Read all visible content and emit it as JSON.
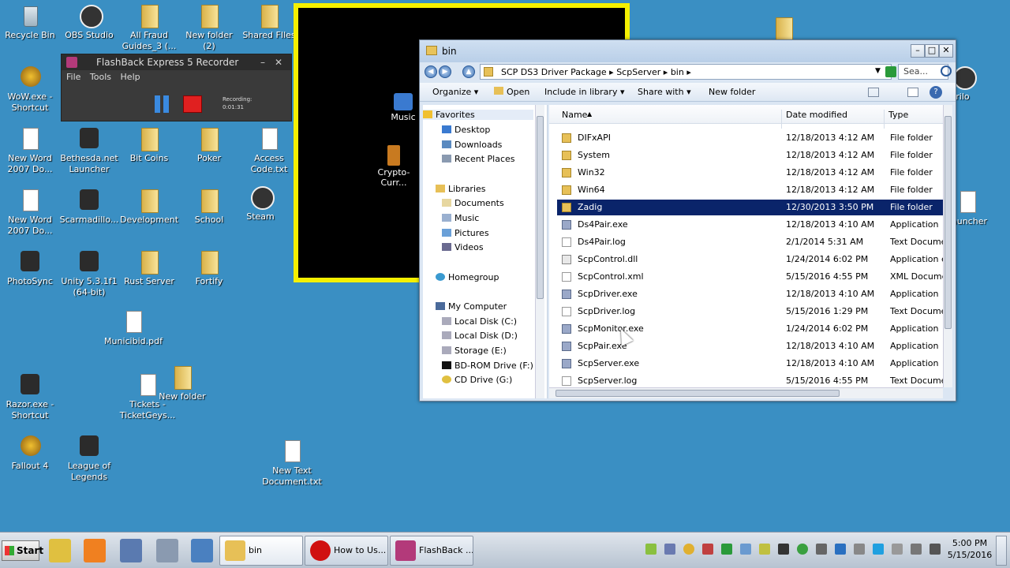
{
  "desktop": {
    "icons": {
      "recycle_bin": "Recycle Bin",
      "obs_studio": "OBS Studio",
      "all_fraud": "All Fraud Guides_3 (...",
      "new_folder_2": "New folder (2)",
      "shared_files": "Shared FIles",
      "wow": "WoW.exe - Shortcut",
      "new_word_1": "New Word 2007 Do...",
      "bethesda": "Bethesda.net Launcher",
      "bit_coins": "Bit Coins",
      "poker": "Poker",
      "access_code": "Access Code.txt",
      "new_word_2": "New Word 2007 Do...",
      "scarmadillo": "Scarmadillo...",
      "development": "Development",
      "school": "School",
      "steam": "Steam",
      "photosync": "PhotoSync",
      "unity": "Unity 5.3.1f1 (64-bit)",
      "rust_server": "Rust Server",
      "fortify": "Fortify",
      "municibid": "Municibid.pdf",
      "razor": "Razor.exe - Shortcut",
      "tickets": "Tickets - TicketGeys...",
      "new_folder": "New folder",
      "fallout4": "Fallout 4",
      "lol": "League of Legends",
      "new_text_doc": "New Text Document.txt",
      "ventrilo_partial": "ntrilo",
      "launcher_partial": "auncher"
    }
  },
  "flashback": {
    "title": "FlashBack Express 5 Recorder",
    "minimize": "–",
    "close": "✕",
    "menu": [
      "File",
      "Tools",
      "Help"
    ],
    "recording_label": "Recording:",
    "recording_time": "0:01:31"
  },
  "media_window": {
    "music": "Music",
    "crypto": "Crypto-Curr..."
  },
  "explorer": {
    "title": "bin",
    "address": [
      "SCP DS3 Driver Package",
      "ScpServer",
      "bin"
    ],
    "search_placeholder": "Sea...",
    "toolbar": {
      "organize": "Organize",
      "open": "Open",
      "include": "Include in library",
      "share": "Share with",
      "new_folder": "New folder"
    },
    "nav": {
      "favorites": "Favorites",
      "desktop": "Desktop",
      "downloads": "Downloads",
      "recent": "Recent Places",
      "libraries": "Libraries",
      "documents": "Documents",
      "music": "Music",
      "pictures": "Pictures",
      "videos": "Videos",
      "homegroup": "Homegroup",
      "my_computer": "My Computer",
      "local_c": "Local Disk (C:)",
      "local_d": "Local Disk (D:)",
      "storage_e": "Storage (E:)",
      "bdrom_f": "BD-ROM Drive (F:)",
      "cd_g": "CD Drive (G:)"
    },
    "columns": {
      "name": "Name",
      "date": "Date modified",
      "type": "Type"
    },
    "files": [
      {
        "name": "DIFxAPI",
        "date": "12/18/2013 4:12 AM",
        "type": "File folder",
        "icon": "folder"
      },
      {
        "name": "System",
        "date": "12/18/2013 4:12 AM",
        "type": "File folder",
        "icon": "folder"
      },
      {
        "name": "Win32",
        "date": "12/18/2013 4:12 AM",
        "type": "File folder",
        "icon": "folder"
      },
      {
        "name": "Win64",
        "date": "12/18/2013 4:12 AM",
        "type": "File folder",
        "icon": "folder"
      },
      {
        "name": "Zadig",
        "date": "12/30/2013 3:50 PM",
        "type": "File folder",
        "icon": "folder"
      },
      {
        "name": "Ds4Pair.exe",
        "date": "12/18/2013 4:10 AM",
        "type": "Application",
        "icon": "exe"
      },
      {
        "name": "Ds4Pair.log",
        "date": "2/1/2014 5:31 AM",
        "type": "Text Documen",
        "icon": "txt"
      },
      {
        "name": "ScpControl.dll",
        "date": "1/24/2014 6:02 PM",
        "type": "Application ex",
        "icon": "dll"
      },
      {
        "name": "ScpControl.xml",
        "date": "5/15/2016 4:55 PM",
        "type": "XML Documen",
        "icon": "txt"
      },
      {
        "name": "ScpDriver.exe",
        "date": "12/18/2013 4:10 AM",
        "type": "Application",
        "icon": "exe"
      },
      {
        "name": "ScpDriver.log",
        "date": "5/15/2016 1:29 PM",
        "type": "Text Documen",
        "icon": "txt"
      },
      {
        "name": "ScpMonitor.exe",
        "date": "1/24/2014 6:02 PM",
        "type": "Application",
        "icon": "exe"
      },
      {
        "name": "ScpPair.exe",
        "date": "12/18/2013 4:10 AM",
        "type": "Application",
        "icon": "exe"
      },
      {
        "name": "ScpServer.exe",
        "date": "12/18/2013 4:10 AM",
        "type": "Application",
        "icon": "exe"
      },
      {
        "name": "ScpServer.log",
        "date": "5/15/2016 4:55 PM",
        "type": "Text Documen",
        "icon": "txt"
      }
    ]
  },
  "taskbar": {
    "start": "Start",
    "tasks": {
      "bin": "bin",
      "opera": "How to Us...",
      "flashback": "FlashBack ..."
    },
    "time": "5:00 PM",
    "date": "5/15/2016"
  }
}
